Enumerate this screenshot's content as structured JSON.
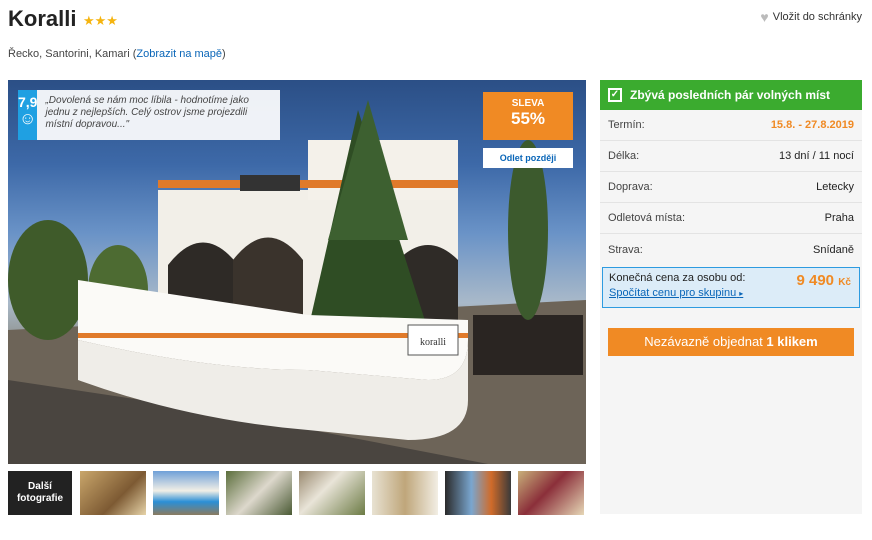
{
  "hotel": {
    "name": "Koralli",
    "stars": "★★★",
    "location": "Řecko, Santorini, Kamari",
    "map_link": "Zobrazit na mapě",
    "favorite_label": "Vložit do schránky"
  },
  "review": {
    "score": "7,9",
    "quote": "„Dovolená se nám moc líbila - hodnotíme jako jednu z nejlepších. Celý ostrov jsme projezdili místní dopravou...\""
  },
  "sale": {
    "label": "SLEVA",
    "percent": "55%",
    "departures_button": "Odlet později"
  },
  "gallery": {
    "more_label_1": "Další",
    "more_label_2": "fotografie"
  },
  "offer": {
    "availability": "Zbývá posledních pár volných míst",
    "rows": [
      {
        "key": "Termín:",
        "value": "15.8. - 27.8.2019"
      },
      {
        "key": "Délka:",
        "value": "13 dní / 11 nocí"
      },
      {
        "key": "Doprava:",
        "value": "Letecky"
      },
      {
        "key": "Odletová místa:",
        "value": "Praha"
      },
      {
        "key": "Strava:",
        "value": "Snídaně"
      }
    ],
    "price_label": "Konečná cena za osobu od:",
    "price_value": "9 490",
    "price_currency": "Kč",
    "group_link": "Spočítat cenu pro skupinu",
    "order_text": "Nezávazně objednat",
    "order_bold": "1 klikem"
  },
  "colors": {
    "accent_orange": "#f08a24",
    "availability_green": "#3bab2f",
    "rating_blue": "#1fa0e2",
    "link_blue": "#0a66b8"
  }
}
